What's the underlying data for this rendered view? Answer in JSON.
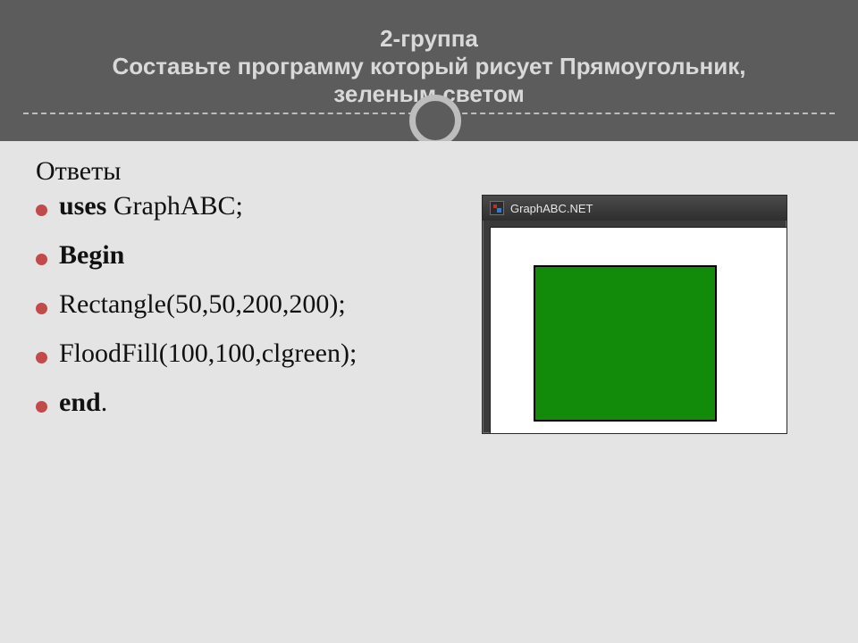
{
  "header": {
    "line1": "2-группа",
    "line2": "Составьте программу который рисует Прямоугольник,",
    "line3": "зеленым светом"
  },
  "answers_label": "Ответы",
  "code_lines": [
    {
      "bold": "uses",
      "rest": " GraphABC;"
    },
    {
      "bold": "Begin",
      "rest": ""
    },
    {
      "bold": "",
      "rest": "Rectangle(50,50,200,200);"
    },
    {
      "bold": "",
      "rest": "FloodFill(100,100,clgreen);"
    },
    {
      "bold": "end",
      "rest": "."
    }
  ],
  "app_window": {
    "title": "GraphABC.NET",
    "rect_fill": "#128a0a"
  }
}
